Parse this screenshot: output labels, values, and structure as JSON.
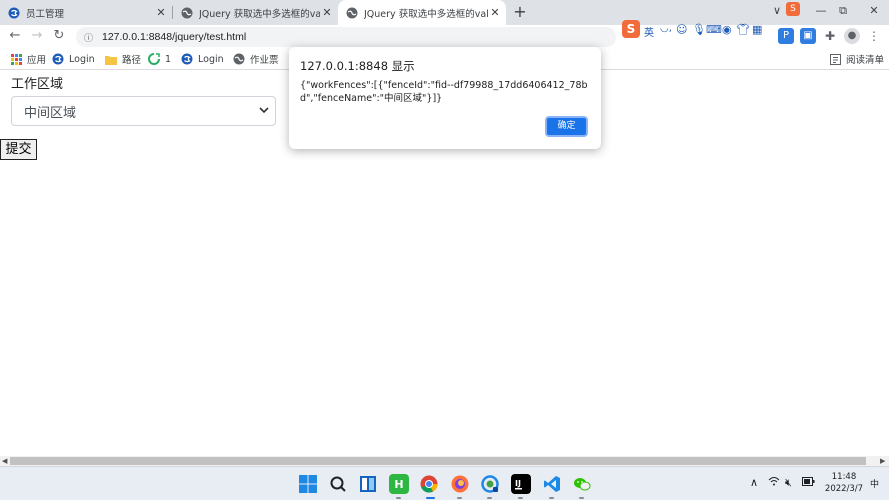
{
  "browser": {
    "tabs": [
      {
        "title": "员工管理",
        "active": false
      },
      {
        "title": "JQuery 获取选中多选框的value值",
        "active": false
      },
      {
        "title": "JQuery 获取选中多选框的value值",
        "active": true
      }
    ],
    "new_tab": "+",
    "window_controls": [
      "∨",
      "—",
      "⧉",
      "✕"
    ],
    "url": "127.0.0.1:8848/jquery/test.html",
    "ime_label": "英",
    "bookmarks": [
      {
        "label": "应用",
        "icon": "apps-grid-icon"
      },
      {
        "label": "Login",
        "icon": "site-logo-icon"
      },
      {
        "label": "路径",
        "icon": "folder-icon"
      },
      {
        "label": "1",
        "icon": "refresh-green-icon"
      },
      {
        "label": "Login",
        "icon": "site-logo-icon"
      },
      {
        "label": "作业票",
        "icon": "globe-icon"
      }
    ],
    "reading_list": "阅读清单"
  },
  "page": {
    "field_label": "工作区域",
    "select_value": "中间区域",
    "submit_label": "提交"
  },
  "dialog": {
    "title": "127.0.0.1:8848 显示",
    "message": "{\"workFences\":[{\"fenceId\":\"fid--df79988_17dd6406412_78bd\",\"fenceName\":\"中间区域\"}]}",
    "ok_label": "确定"
  },
  "taskbar": {
    "apps": [
      "windows-start",
      "search",
      "file-explorer",
      "hbuilder",
      "chrome",
      "firefox",
      "edge-beta",
      "intellij",
      "vscode",
      "wechat"
    ],
    "ime_indicator": "中",
    "time": "11:48",
    "date": "2022/3/7"
  },
  "colors": {
    "accent": "#1a73e8",
    "tabstrip": "#dee1e6",
    "taskbar": "#e8edf3"
  }
}
